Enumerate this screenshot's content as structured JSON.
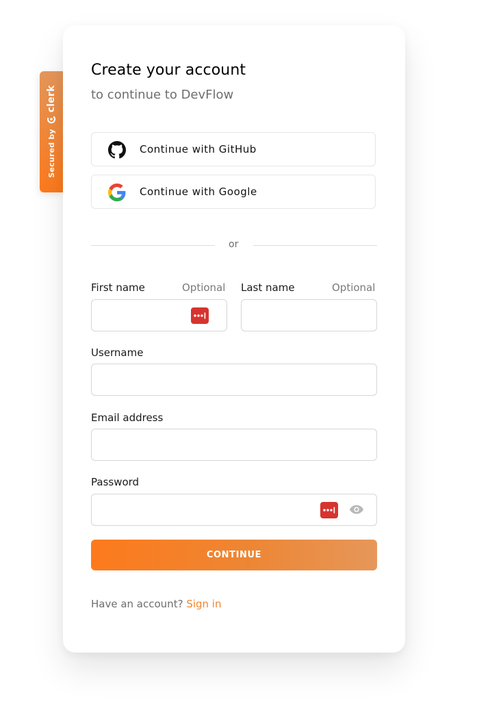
{
  "badge": {
    "secured_text": "Secured by",
    "brand": "clerk"
  },
  "header": {
    "title": "Create your account",
    "subtitle": "to continue to DevFlow"
  },
  "social": {
    "github_label": "Continue with GitHub",
    "github_icon": "github-icon",
    "google_label": "Continue with Google",
    "google_icon": "google-icon"
  },
  "divider": {
    "text": "or"
  },
  "form": {
    "first_name": {
      "label": "First name",
      "optional": "Optional",
      "value": ""
    },
    "last_name": {
      "label": "Last name",
      "optional": "Optional",
      "value": ""
    },
    "username": {
      "label": "Username",
      "value": ""
    },
    "email": {
      "label": "Email address",
      "value": ""
    },
    "password": {
      "label": "Password",
      "value": ""
    },
    "continue_label": "CONTINUE"
  },
  "footer": {
    "prompt": "Have an account?",
    "link": "Sign in"
  },
  "colors": {
    "accent": "#fd7a1c",
    "accent_light": "#e6975a",
    "link": "#f0852d",
    "password_manager": "#d7342f"
  }
}
